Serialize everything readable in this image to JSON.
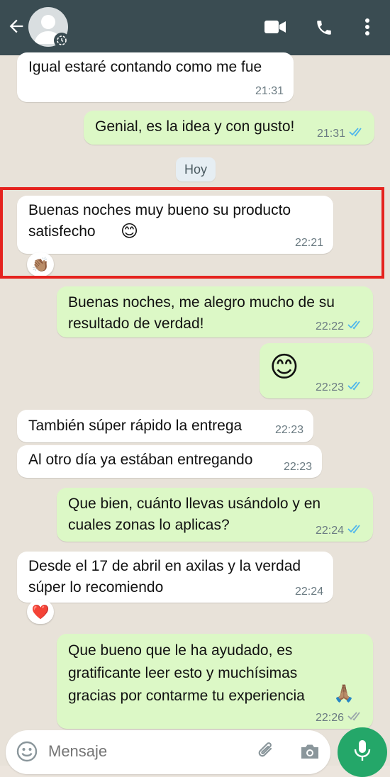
{
  "header": {
    "icons": [
      "back-arrow-icon",
      "avatar",
      "video-call-icon",
      "phone-icon",
      "more-options-icon"
    ]
  },
  "messages": [
    {
      "text": "Igual estaré contando como me fue",
      "time": "21:31"
    },
    {
      "text": "Genial, es la idea y con gusto!",
      "time": "21:31"
    },
    {
      "text": "Buenas noches muy bueno su producto\nsatisfecho",
      "emoji": "😊",
      "time": "22:21",
      "reaction": "👏🏽"
    },
    {
      "text": "Buenas noches, me alegro mucho de su\nresultado de verdad!",
      "time": "22:22"
    },
    {
      "emoji": "😊",
      "time": "22:23"
    },
    {
      "text": "También súper rápido la entrega",
      "time": "22:23"
    },
    {
      "text": "Al otro día ya estában entregando",
      "time": "22:23"
    },
    {
      "text": "Que bien, cuánto llevas usándolo y en\ncuales zonas lo aplicas?",
      "time": "22:24"
    },
    {
      "text": "Desde el 17 de abril en axilas y la verdad\nsúper lo recomiendo",
      "time": "22:24",
      "reaction": "❤️"
    },
    {
      "text": "Que bueno que le ha ayudado, es\ngratificante leer esto y muchísimas\ngracias por contarme tu experiencia",
      "emoji": "🙏🏽",
      "time": "22:26"
    }
  ],
  "day_separator": "Hoy",
  "input": {
    "placeholder": "Mensaje"
  },
  "colors": {
    "header": "#3a4c52",
    "outgoing": "#dcf8c6",
    "incoming": "#ffffff",
    "ticks_read": "#4fb6ec",
    "mic": "#24a769",
    "highlight": "#e5231f"
  }
}
